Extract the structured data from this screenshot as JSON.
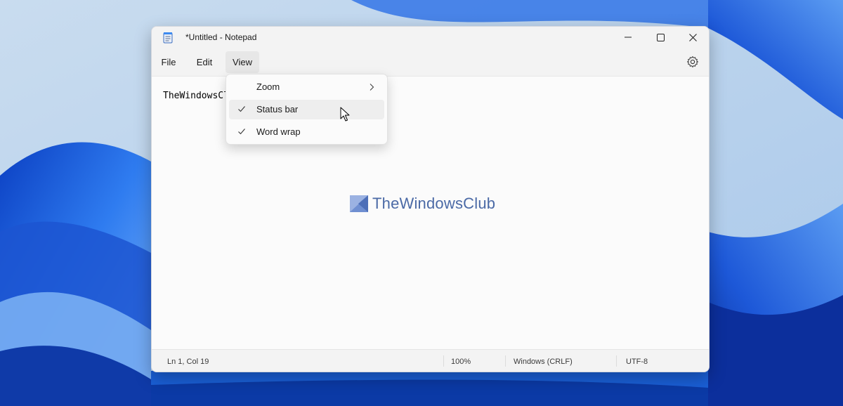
{
  "window": {
    "title": "*Untitled - Notepad"
  },
  "menubar": {
    "items": [
      "File",
      "Edit",
      "View"
    ],
    "active": "View"
  },
  "editor": {
    "text": "TheWindowsCl"
  },
  "watermark": {
    "text": "TheWindowsClub"
  },
  "view_menu": {
    "items": [
      {
        "label": "Zoom",
        "checked": false,
        "submenu": true
      },
      {
        "label": "Status bar",
        "checked": true,
        "submenu": false
      },
      {
        "label": "Word wrap",
        "checked": true,
        "submenu": false
      }
    ]
  },
  "statusbar": {
    "position": "Ln 1, Col 19",
    "zoom": "100%",
    "line_ending": "Windows (CRLF)",
    "encoding": "UTF-8"
  },
  "icons": {
    "app": "notepad-icon",
    "minimize": "minimize-icon",
    "maximize": "maximize-icon",
    "close": "close-icon",
    "settings": "gear-icon",
    "check": "checkmark-icon",
    "submenu": "chevron-right-icon",
    "cursor": "mouse-pointer-icon"
  },
  "colors": {
    "wallpaper_bg": "#b9d3ec",
    "wallpaper_accent": "#1a5fd6",
    "watermark": "#4b6aa6"
  }
}
